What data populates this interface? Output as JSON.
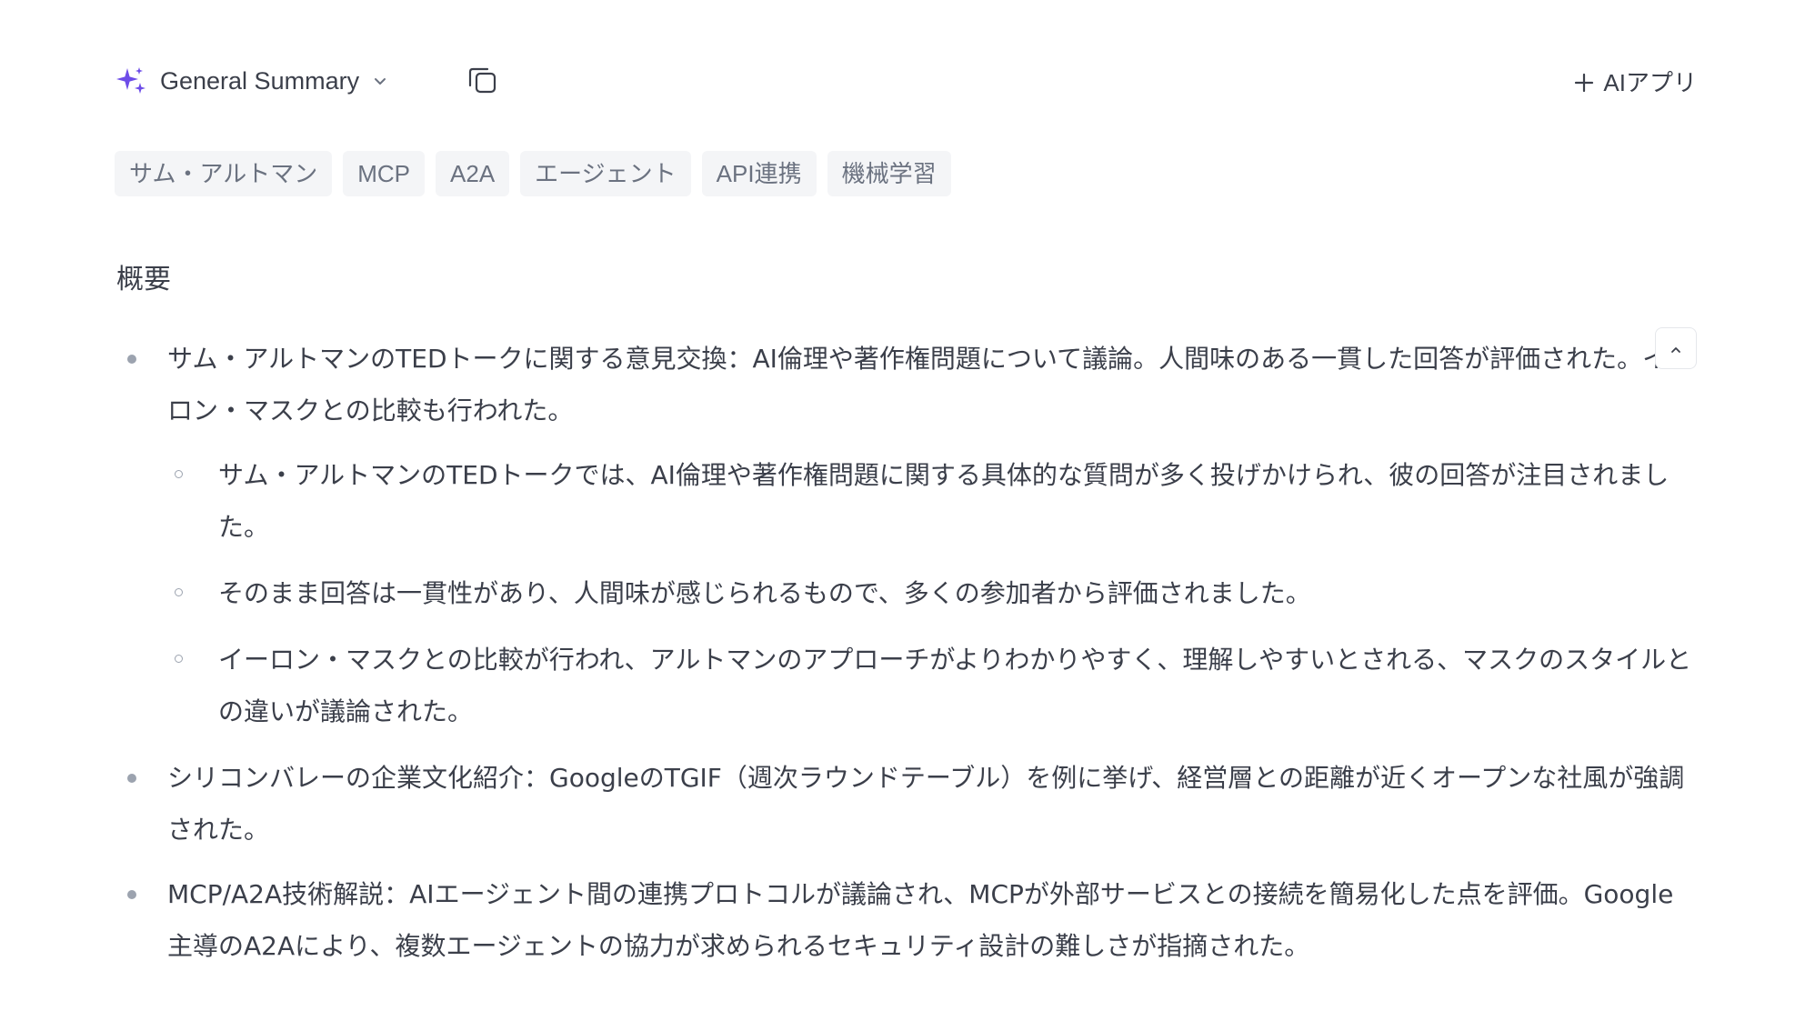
{
  "header": {
    "summary_label": "General Summary",
    "add_app_label": "AIアプリ"
  },
  "tags": [
    "サム・アルトマン",
    "MCP",
    "A2A",
    "エージェント",
    "API連携",
    "機械学習"
  ],
  "section": {
    "title": "概要"
  },
  "items": [
    {
      "text": "サム・アルトマンのTEDトークに関する意見交換：AI倫理や著作権問題について議論。人間味のある一貫した回答が評価された。イーロン・マスクとの比較も行われた。",
      "sub": [
        "サム・アルトマンのTEDトークでは、AI倫理や著作権問題に関する具体的な質問が多く投げかけられ、彼の回答が注目されました。",
        "そのまま回答は一貫性があり、人間味が感じられるもので、多くの参加者から評価されました。",
        "イーロン・マスクとの比較が行われ、アルトマンのアプローチがよりわかりやすく、理解しやすいとされる、マスクのスタイルとの違いが議論された。"
      ]
    },
    {
      "text": "シリコンバレーの企業文化紹介：GoogleのTGIF（週次ラウンドテーブル）を例に挙げ、経営層との距離が近くオープンな社風が強調された。"
    },
    {
      "text": "MCP/A2A技術解説：AIエージェント間の連携プロトコルが議論され、MCPが外部サービスとの接続を簡易化した点を評価。Google主導のA2Aにより、複数エージェントの協力が求められるセキュリティ設計の難しさが指摘された。"
    }
  ],
  "colors": {
    "accent_sparkle": "#6d4ce8",
    "text": "#3b3f4a",
    "tag_bg": "#f4f5f7",
    "bullet": "#9ca3af"
  }
}
